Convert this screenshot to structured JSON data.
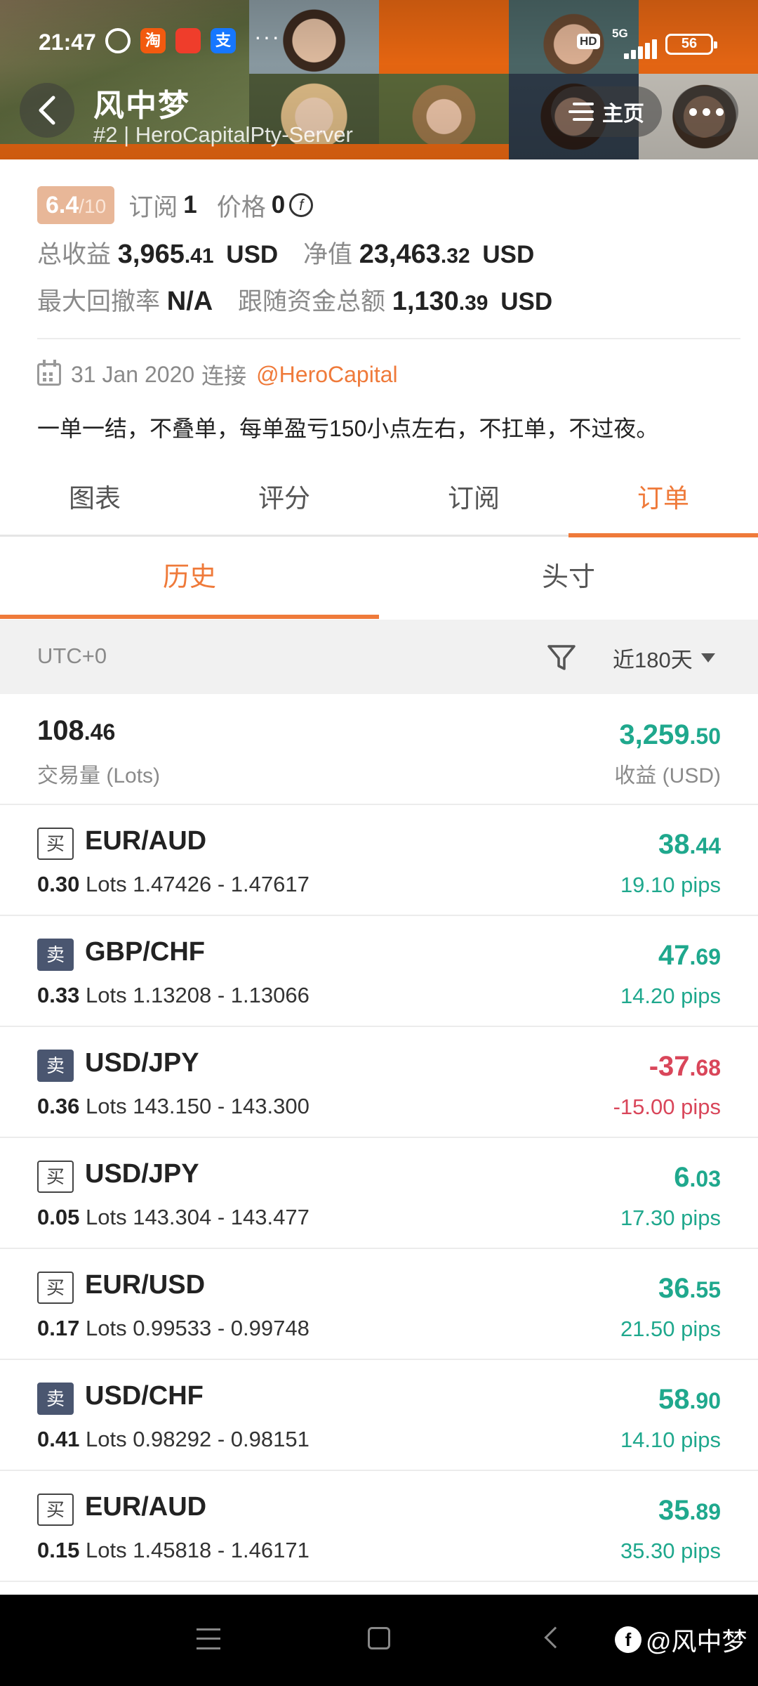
{
  "status_bar": {
    "time": "21:47",
    "app_badges": [
      "淘",
      "",
      "支"
    ],
    "more": "···",
    "hd": "HD",
    "network": "5G",
    "battery": "56"
  },
  "header": {
    "title": "风中梦",
    "subtitle": "#2 | HeroCapitalPty-Server",
    "home_label": "主页"
  },
  "summary": {
    "rating": "6.4",
    "rating_max": "/10",
    "subscribe_label": "订阅",
    "subscribe_value": "1",
    "price_label": "价格",
    "price_value": "0",
    "coin_symbol": "f",
    "total_profit_label": "总收益",
    "total_profit_int": "3,965",
    "total_profit_dec": ".41",
    "total_profit_unit": "USD",
    "net_value_label": "净值",
    "net_value_int": "23,463",
    "net_value_dec": ".32",
    "net_value_unit": "USD",
    "max_drawdown_label": "最大回撤率",
    "max_drawdown_value": "N/A",
    "follow_funds_label": "跟随资金总额",
    "follow_funds_int": "1,130",
    "follow_funds_dec": ".39",
    "follow_funds_unit": "USD",
    "connect_date": "31 Jan 2020",
    "connect_label": "连接",
    "handle": "@HeroCapital",
    "description": "一单一结，不叠单，每单盈亏150小点左右，不扛单，不过夜。"
  },
  "tabs": [
    "图表",
    "评分",
    "订阅",
    "订单"
  ],
  "subtabs": [
    "历史",
    "头寸"
  ],
  "filter": {
    "timezone": "UTC+0",
    "range": "近180天"
  },
  "totals": {
    "lots_int": "108",
    "lots_dec": ".46",
    "lots_label": "交易量 (Lots)",
    "profit_int": "3,259",
    "profit_dec": ".50",
    "profit_label": "收益 (USD)"
  },
  "lots_unit": "Lots",
  "orders": [
    {
      "side": "买",
      "pair": "EUR/AUD",
      "lots": "0.30",
      "range": "1.47426 - 1.47617",
      "pl_int": "38",
      "pl_dec": ".44",
      "pips": "19.10 pips",
      "positive": true
    },
    {
      "side": "卖",
      "pair": "GBP/CHF",
      "lots": "0.33",
      "range": "1.13208 - 1.13066",
      "pl_int": "47",
      "pl_dec": ".69",
      "pips": "14.20 pips",
      "positive": true
    },
    {
      "side": "卖",
      "pair": "USD/JPY",
      "lots": "0.36",
      "range": "143.150 - 143.300",
      "pl_int": "-37",
      "pl_dec": ".68",
      "pips": "-15.00 pips",
      "positive": false
    },
    {
      "side": "买",
      "pair": "USD/JPY",
      "lots": "0.05",
      "range": "143.304 - 143.477",
      "pl_int": "6",
      "pl_dec": ".03",
      "pips": "17.30 pips",
      "positive": true
    },
    {
      "side": "买",
      "pair": "EUR/USD",
      "lots": "0.17",
      "range": "0.99533 - 0.99748",
      "pl_int": "36",
      "pl_dec": ".55",
      "pips": "21.50 pips",
      "positive": true
    },
    {
      "side": "卖",
      "pair": "USD/CHF",
      "lots": "0.41",
      "range": "0.98292 - 0.98151",
      "pl_int": "58",
      "pl_dec": ".90",
      "pips": "14.10 pips",
      "positive": true
    },
    {
      "side": "买",
      "pair": "EUR/AUD",
      "lots": "0.15",
      "range": "1.45818 - 1.46171",
      "pl_int": "35",
      "pl_dec": ".89",
      "pips": "35.30 pips",
      "positive": true
    }
  ],
  "watermark": "@风中梦",
  "colors": {
    "accent": "#ef7a3a",
    "profit": "#1fa88d",
    "loss": "#d9465a",
    "sell_badge": "#4a5670"
  }
}
